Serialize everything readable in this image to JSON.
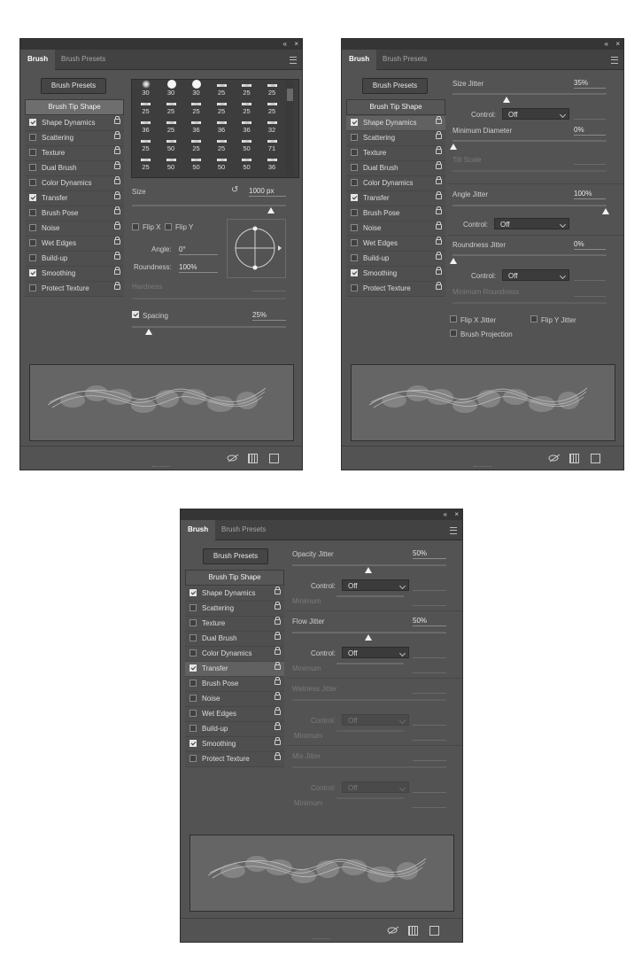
{
  "common": {
    "tabs": [
      "Brush",
      "Brush Presets"
    ],
    "brush_presets_button": "Brush Presets",
    "tip_shape": "Brush Tip Shape",
    "options": [
      {
        "label": "Shape Dynamics",
        "checked": true
      },
      {
        "label": "Scattering",
        "checked": false
      },
      {
        "label": "Texture",
        "checked": false
      },
      {
        "label": "Dual Brush",
        "checked": false
      },
      {
        "label": "Color Dynamics",
        "checked": false
      },
      {
        "label": "Transfer",
        "checked": true
      },
      {
        "label": "Brush Pose",
        "checked": false
      },
      {
        "label": "Noise",
        "checked": false
      },
      {
        "label": "Wet Edges",
        "checked": false
      },
      {
        "label": "Build-up",
        "checked": false
      },
      {
        "label": "Smoothing",
        "checked": true
      },
      {
        "label": "Protect Texture",
        "checked": false
      }
    ],
    "collapse_icon": "«",
    "close_icon": "×"
  },
  "panel1": {
    "brush_sizes": [
      "30",
      "30",
      "30",
      "25",
      "25",
      "25",
      "25",
      "25",
      "25",
      "25",
      "25",
      "25",
      "36",
      "25",
      "36",
      "36",
      "36",
      "32",
      "25",
      "50",
      "25",
      "25",
      "50",
      "71",
      "25",
      "50",
      "50",
      "50",
      "50",
      "36"
    ],
    "size_label": "Size",
    "size_value": "1000 px",
    "flip_x": "Flip X",
    "flip_y": "Flip Y",
    "angle_label": "Angle:",
    "angle_value": "0°",
    "roundness_label": "Roundness:",
    "roundness_value": "100%",
    "hardness_label": "Hardness",
    "spacing_label": "Spacing",
    "spacing_value": "25%",
    "spacing_fraction": 0.19
  },
  "panel2": {
    "size_jitter_label": "Size Jitter",
    "size_jitter_value": "35%",
    "control_label": "Control:",
    "control_value": "Off",
    "min_diameter_label": "Minimum Diameter",
    "min_diameter_value": "0%",
    "tilt_scale_label": "Tilt Scale",
    "angle_jitter_label": "Angle Jitter",
    "angle_jitter_value": "100%",
    "roundness_jitter_label": "Roundness Jitter",
    "roundness_jitter_value": "0%",
    "min_roundness_label": "Minimum Roundness",
    "flip_x_jitter": "Flip X Jitter",
    "flip_y_jitter": "Flip Y Jitter",
    "brush_projection": "Brush Projection"
  },
  "panel3": {
    "opacity_jitter_label": "Opacity Jitter",
    "opacity_jitter_value": "50%",
    "control_label": "Control:",
    "control_value": "Off",
    "minimum_label": "Minimum",
    "flow_jitter_label": "Flow Jitter",
    "flow_jitter_value": "50%",
    "wetness_jitter_label": "Wetness Jitter",
    "mix_jitter_label": "Mix Jitter"
  }
}
